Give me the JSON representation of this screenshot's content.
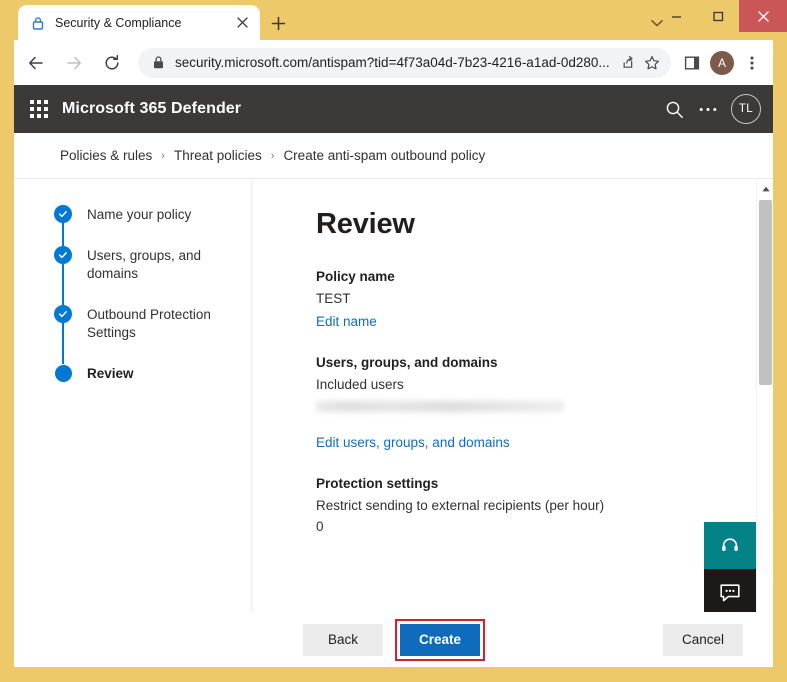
{
  "browser": {
    "tab": {
      "title": "Security & Compliance",
      "favicon_icon": "lock-icon",
      "close_icon": "close-icon"
    },
    "new_tab_label": "+",
    "tab_list_icon": "chevron-down-icon",
    "window_controls": {
      "minimize": "–",
      "maximize": "❐",
      "close": "✕"
    },
    "nav": {
      "back_icon": "arrow-left-icon",
      "forward_icon": "arrow-right-icon",
      "reload_icon": "reload-icon"
    },
    "omnibox": {
      "url": "security.microsoft.com/antispam?tid=4f73a04d-7b23-4216-a1ad-0d280...",
      "lock_icon": "padlock-icon",
      "share_icon": "share-icon",
      "bookmark_icon": "star-icon"
    },
    "toolbar": {
      "collections_icon": "collections-icon",
      "profile_initial": "A",
      "menu_icon": "three-dots-vertical-icon"
    }
  },
  "suite_bar": {
    "waffle_icon": "app-launcher-icon",
    "title": "Microsoft 365 Defender",
    "search_icon": "search-icon",
    "more_icon": "ellipsis-icon",
    "avatar_initials": "TL"
  },
  "breadcrumb": {
    "separator": "›",
    "items": [
      {
        "label": "Policies & rules"
      },
      {
        "label": "Threat policies"
      },
      {
        "label": "Create anti-spam outbound policy"
      }
    ]
  },
  "wizard": {
    "steps": [
      {
        "label": "Name your policy",
        "state": "done"
      },
      {
        "label": "Users, groups, and domains",
        "state": "done"
      },
      {
        "label": "Outbound Protection Settings",
        "state": "done"
      },
      {
        "label": "Review",
        "state": "current"
      }
    ]
  },
  "review": {
    "title": "Review",
    "policy_name_heading": "Policy name",
    "policy_name_value": "TEST",
    "edit_name_link": "Edit name",
    "users_heading": "Users, groups, and domains",
    "included_users_label": "Included users",
    "included_users_value": "",
    "edit_users_link": "Edit users, groups, and domains",
    "protection_heading": "Protection settings",
    "restrict_label": "Restrict sending to external recipients (per hour)",
    "restrict_value": "0"
  },
  "widgets": {
    "help_icon": "help-headset-icon",
    "feedback_icon": "feedback-chat-icon"
  },
  "scrollbar": {
    "up_icon": "caret-up-icon",
    "down_icon": "caret-down-icon"
  },
  "footer": {
    "back_label": "Back",
    "create_label": "Create",
    "cancel_label": "Cancel"
  },
  "colors": {
    "accent_blue": "#0078d4",
    "primary_button": "#0f6cbd",
    "link": "#0f6cbd",
    "suite_bar": "#3b3a39",
    "window_chrome": "#eec96a",
    "close_button": "#cb5658",
    "help_widget": "#038387",
    "feedback_widget": "#1b1a19",
    "annotation_outline": "#d6202e"
  }
}
